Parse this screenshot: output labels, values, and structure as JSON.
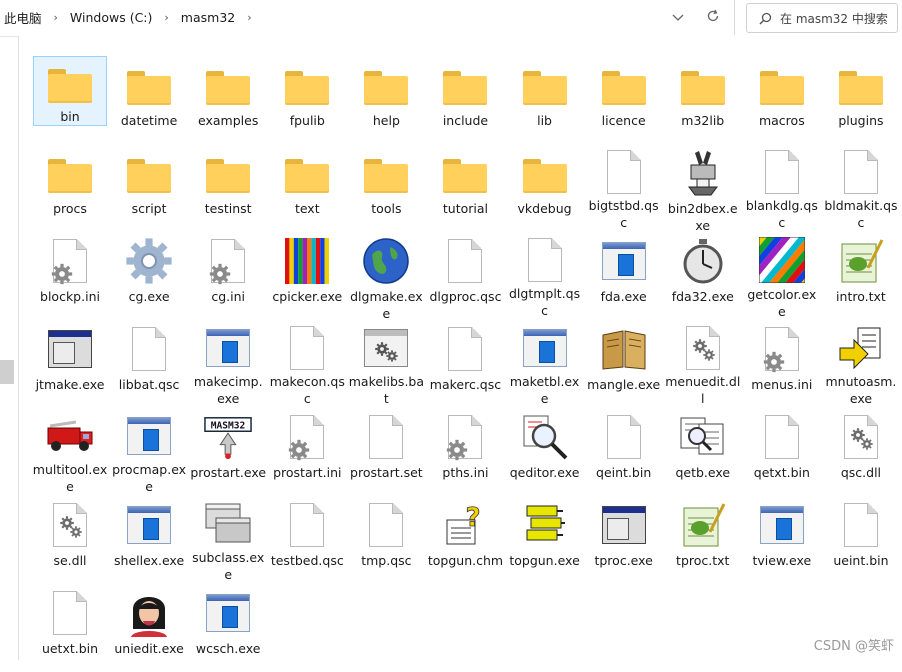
{
  "breadcrumb": [
    "此电脑",
    "Windows (C:)",
    "masm32"
  ],
  "search": {
    "placeholder": "在 masm32 中搜索"
  },
  "watermark": "CSDN @笑虾",
  "items": [
    {
      "label": "bin",
      "icon": "folder",
      "selected": true
    },
    {
      "label": "datetime",
      "icon": "folder"
    },
    {
      "label": "examples",
      "icon": "folder"
    },
    {
      "label": "fpulib",
      "icon": "folder"
    },
    {
      "label": "help",
      "icon": "folder"
    },
    {
      "label": "include",
      "icon": "folder"
    },
    {
      "label": "lib",
      "icon": "folder"
    },
    {
      "label": "licence",
      "icon": "folder"
    },
    {
      "label": "m32lib",
      "icon": "folder"
    },
    {
      "label": "macros",
      "icon": "folder"
    },
    {
      "label": "plugins",
      "icon": "folder"
    },
    {
      "label": "procs",
      "icon": "folder"
    },
    {
      "label": "script",
      "icon": "folder"
    },
    {
      "label": "testinst",
      "icon": "folder"
    },
    {
      "label": "text",
      "icon": "folder"
    },
    {
      "label": "tools",
      "icon": "folder"
    },
    {
      "label": "tutorial",
      "icon": "folder"
    },
    {
      "label": "vkdebug",
      "icon": "folder"
    },
    {
      "label": "bigtstbd.qsc",
      "icon": "doc"
    },
    {
      "label": "bin2dbex.exe",
      "icon": "bin2dbex"
    },
    {
      "label": "blankdlg.qsc",
      "icon": "doc"
    },
    {
      "label": "bldmakit.qsc",
      "icon": "doc"
    },
    {
      "label": "blockp.ini",
      "icon": "ini"
    },
    {
      "label": "cg.exe",
      "icon": "bigear"
    },
    {
      "label": "cg.ini",
      "icon": "ini"
    },
    {
      "label": "cpicker.exe",
      "icon": "stripes"
    },
    {
      "label": "dlgmake.exe",
      "icon": "globe"
    },
    {
      "label": "dlgproc.qsc",
      "icon": "doc"
    },
    {
      "label": "dlgtmplt.qsc",
      "icon": "doc"
    },
    {
      "label": "fda.exe",
      "icon": "win"
    },
    {
      "label": "fda32.exe",
      "icon": "stopwatch"
    },
    {
      "label": "getcolor.exe",
      "icon": "diag"
    },
    {
      "label": "intro.txt",
      "icon": "notepad"
    },
    {
      "label": "jtmake.exe",
      "icon": "dlgbox"
    },
    {
      "label": "libbat.qsc",
      "icon": "doc"
    },
    {
      "label": "makecimp.exe",
      "icon": "win"
    },
    {
      "label": "makecon.qsc",
      "icon": "doc"
    },
    {
      "label": "makelibs.bat",
      "icon": "bat"
    },
    {
      "label": "makerc.qsc",
      "icon": "doc"
    },
    {
      "label": "maketbl.exe",
      "icon": "win"
    },
    {
      "label": "mangle.exe",
      "icon": "book"
    },
    {
      "label": "menuedit.dll",
      "icon": "dll"
    },
    {
      "label": "menus.ini",
      "icon": "ini"
    },
    {
      "label": "mnutoasm.exe",
      "icon": "arrowdoc"
    },
    {
      "label": "multitool.exe",
      "icon": "firetruck"
    },
    {
      "label": "procmap.exe",
      "icon": "win"
    },
    {
      "label": "prostart.exe",
      "icon": "masm32"
    },
    {
      "label": "prostart.ini",
      "icon": "ini"
    },
    {
      "label": "prostart.set",
      "icon": "doc"
    },
    {
      "label": "pths.ini",
      "icon": "ini"
    },
    {
      "label": "qeditor.exe",
      "icon": "magnifier"
    },
    {
      "label": "qeint.bin",
      "icon": "doc"
    },
    {
      "label": "qetb.exe",
      "icon": "qetb"
    },
    {
      "label": "qetxt.bin",
      "icon": "doc"
    },
    {
      "label": "qsc.dll",
      "icon": "dll"
    },
    {
      "label": "se.dll",
      "icon": "dll"
    },
    {
      "label": "shellex.exe",
      "icon": "win"
    },
    {
      "label": "subclass.exe",
      "icon": "subclass"
    },
    {
      "label": "testbed.qsc",
      "icon": "doc"
    },
    {
      "label": "tmp.qsc",
      "icon": "doc"
    },
    {
      "label": "topgun.chm",
      "icon": "help"
    },
    {
      "label": "topgun.exe",
      "icon": "stack"
    },
    {
      "label": "tproc.exe",
      "icon": "dlgbox"
    },
    {
      "label": "tproc.txt",
      "icon": "notepad"
    },
    {
      "label": "tview.exe",
      "icon": "win"
    },
    {
      "label": "ueint.bin",
      "icon": "doc"
    },
    {
      "label": "uetxt.bin",
      "icon": "doc"
    },
    {
      "label": "uniedit.exe",
      "icon": "portrait"
    },
    {
      "label": "wcsch.exe",
      "icon": "win"
    }
  ]
}
